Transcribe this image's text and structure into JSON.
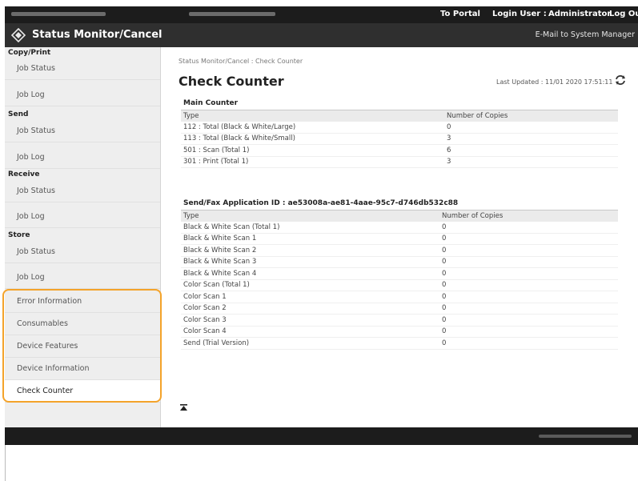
{
  "topbar": {
    "portal_link": "To Portal",
    "login_user_label": "Login User :",
    "user_name": "Administrator",
    "logout_link": "Log Out"
  },
  "header": {
    "title": "Status Monitor/Cancel",
    "mail_link": "E-Mail to System Manager"
  },
  "sidebar": {
    "sections": [
      {
        "heading": "Copy/Print",
        "items": [
          "Job Status",
          "Job Log"
        ]
      },
      {
        "heading": "Send",
        "items": [
          "Job Status",
          "Job Log"
        ]
      },
      {
        "heading": "Receive",
        "items": [
          "Job Status",
          "Job Log"
        ]
      },
      {
        "heading": "Store",
        "items": [
          "Job Status",
          "Job Log"
        ]
      }
    ],
    "extra_items": [
      "Error Information",
      "Consumables",
      "Device Features",
      "Device Information",
      "Check Counter"
    ],
    "active_item": "Check Counter"
  },
  "main": {
    "breadcrumb": "Status Monitor/Cancel : Check Counter",
    "title": "Check Counter",
    "last_updated": "Last Updated : 11/01 2020 17:51:11",
    "main_counter": {
      "heading": "Main Counter",
      "columns": [
        "Type",
        "Number of Copies"
      ],
      "rows": [
        [
          "112 : Total (Black & White/Large)",
          "0"
        ],
        [
          "113 : Total (Black & White/Small)",
          "3"
        ],
        [
          "501 : Scan (Total 1)",
          "6"
        ],
        [
          "301 : Print (Total 1)",
          "3"
        ]
      ]
    },
    "send_fax": {
      "heading": "Send/Fax Application ID : ae53008a-ae81-4aae-95c7-d746db532c88",
      "columns": [
        "Type",
        "Number of Copies"
      ],
      "rows": [
        [
          "Black & White Scan (Total 1)",
          "0"
        ],
        [
          "Black & White Scan 1",
          "0"
        ],
        [
          "Black & White Scan 2",
          "0"
        ],
        [
          "Black & White Scan 3",
          "0"
        ],
        [
          "Black & White Scan 4",
          "0"
        ],
        [
          "Color Scan (Total 1)",
          "0"
        ],
        [
          "Color Scan 1",
          "0"
        ],
        [
          "Color Scan 2",
          "0"
        ],
        [
          "Color Scan 3",
          "0"
        ],
        [
          "Color Scan 4",
          "0"
        ],
        [
          "Send (Trial Version)",
          "0"
        ]
      ]
    }
  },
  "colors": {
    "topbar_bg": "#1c1c1c",
    "titlebar_bg": "#2f2f2f",
    "sidebar_bg": "#eeeeee",
    "highlight_border": "#f4a32a"
  },
  "icons": [
    "app-logo-icon",
    "refresh-icon",
    "back-to-top-icon"
  ]
}
